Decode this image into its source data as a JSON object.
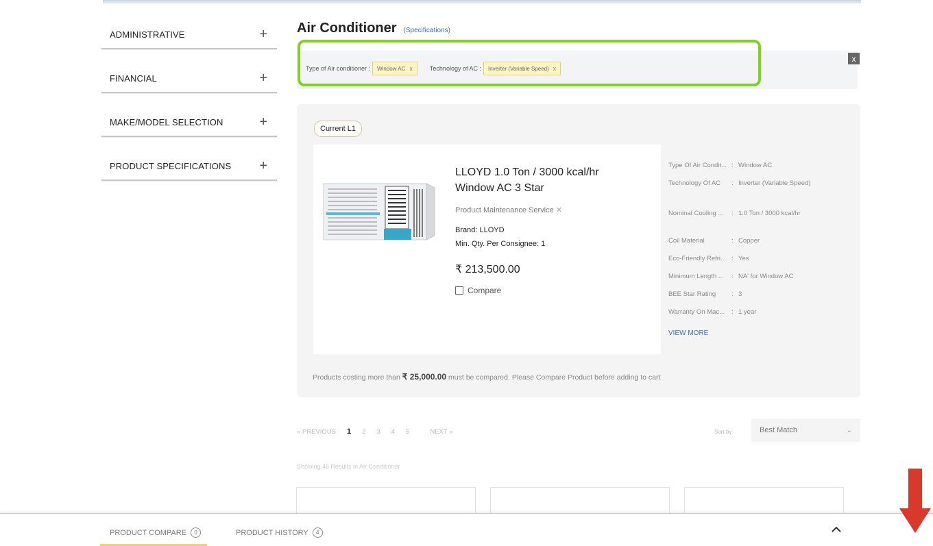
{
  "sidebar": {
    "items": [
      {
        "label": "ADMINISTRATIVE"
      },
      {
        "label": "FINANCIAL"
      },
      {
        "label": "MAKE/MODEL SELECTION"
      },
      {
        "label": "PRODUCT SPECIFICATIONS"
      }
    ],
    "expand_icon": "plus-icon"
  },
  "heading": {
    "title": "Air Conditioner",
    "spec_link": "(Specifications)"
  },
  "filters": [
    {
      "label": "Type of Air conditioner :",
      "chip": "Window AC",
      "remove": "x"
    },
    {
      "label": "Technology of AC :",
      "chip": "Inverter (Variable Speed)",
      "remove": "x"
    }
  ],
  "clear_filters": "x",
  "product": {
    "badge": "Current L1",
    "title": "LLOYD 1.0 Ton / 3000 kcal/hr Window AC 3 Star",
    "service": "Product Maintenance Service",
    "brand": "Brand: LLOYD",
    "min_qty": "Min. Qty. Per Consignee: 1",
    "price": "₹ 213,500.00",
    "compare": "Compare",
    "specs": [
      {
        "key": "Type Of Air Condit...",
        "value": "Window AC"
      },
      {
        "key": "Technology Of AC",
        "value": "Inverter (Variable Speed)"
      },
      {
        "key": "Nominal Cooling ...",
        "value": "1.0 Ton / 3000 kcal/hr"
      },
      {
        "key": "Coil Material",
        "value": "Copper"
      },
      {
        "key": "Eco-Friendly Refri...",
        "value": "Yes"
      },
      {
        "key": "Minimum Length ...",
        "value": "NA' for Window AC"
      },
      {
        "key": "BEE Star Rating",
        "value": "3"
      },
      {
        "key": "Warranty On Mac...",
        "value": "1 year"
      }
    ],
    "view_more": "VIEW MORE"
  },
  "compare_note": {
    "prefix": "Products costing more than",
    "amount": "₹ 25,000.00",
    "suffix": "must be compared. Please Compare Product before adding to cart"
  },
  "pagination": {
    "previous": "« PREVIOUS",
    "pages": [
      "1",
      "2",
      "3",
      "4",
      "5"
    ],
    "current": "1",
    "next": "NEXT »"
  },
  "sort": {
    "label": "Sort by",
    "value": "Best Match"
  },
  "results_note": "Showing 46 Results in Air Conditioner",
  "bottom_bar": {
    "compare_label": "PRODUCT COMPARE",
    "compare_count": "0",
    "history_label": "PRODUCT HISTORY",
    "history_count": "4"
  },
  "colors": {
    "highlight": "#7ed321",
    "annotation_arrow": "#d9392b",
    "link": "#3a6fb5"
  }
}
